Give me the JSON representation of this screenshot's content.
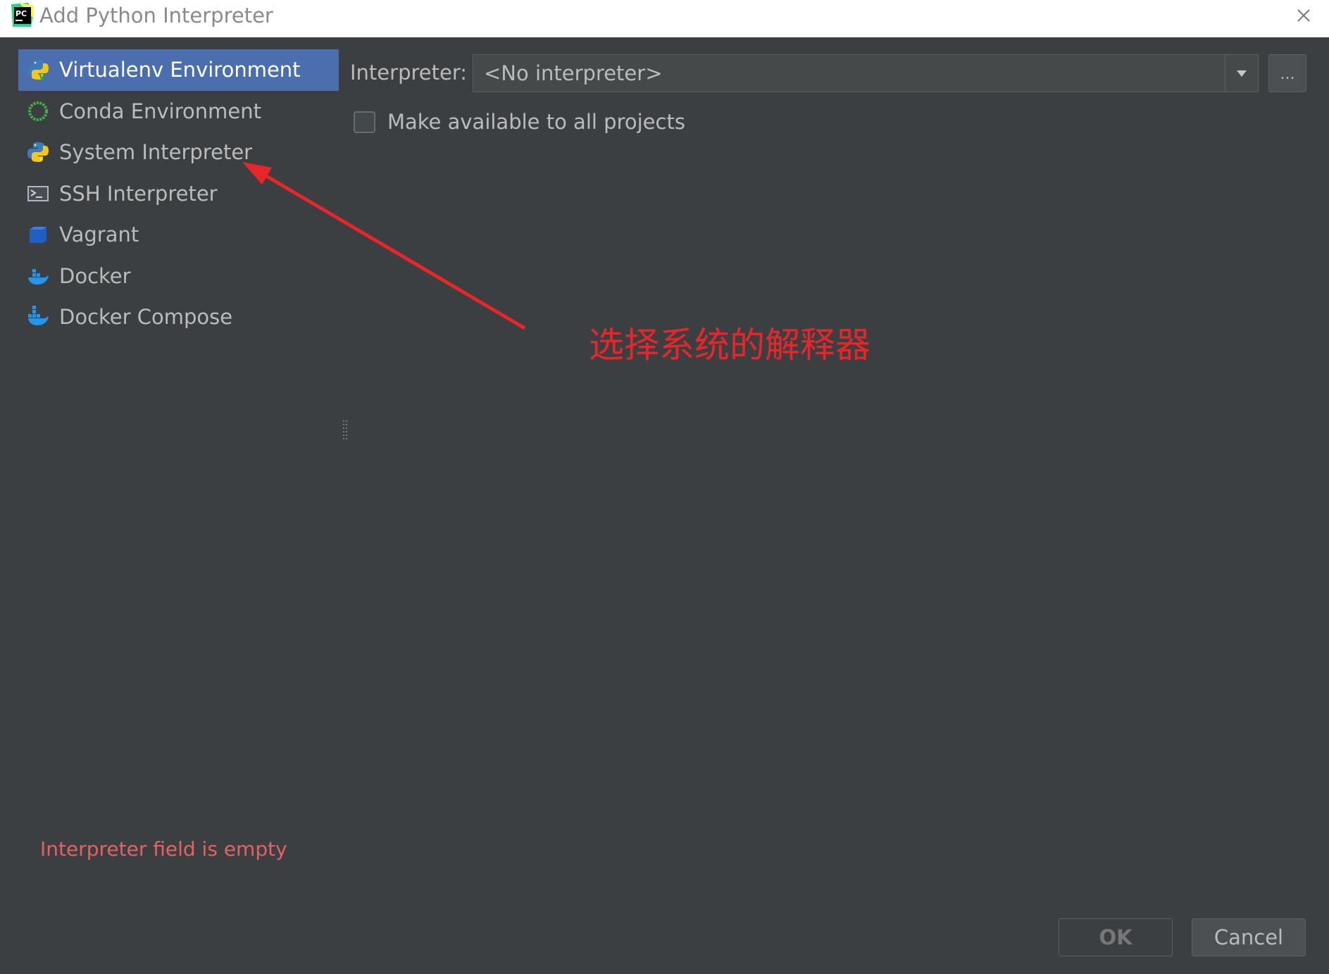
{
  "window": {
    "title": "Add Python Interpreter"
  },
  "sidebar": {
    "items": [
      {
        "label": "Virtualenv Environment",
        "icon": "virtualenv-icon",
        "selected": true
      },
      {
        "label": "Conda Environment",
        "icon": "conda-icon",
        "selected": false
      },
      {
        "label": "System Interpreter",
        "icon": "python-icon",
        "selected": false
      },
      {
        "label": "SSH Interpreter",
        "icon": "terminal-icon",
        "selected": false
      },
      {
        "label": "Vagrant",
        "icon": "vagrant-icon",
        "selected": false
      },
      {
        "label": "Docker",
        "icon": "docker-icon",
        "selected": false
      },
      {
        "label": "Docker Compose",
        "icon": "docker-compose-icon",
        "selected": false
      }
    ]
  },
  "main": {
    "interpreter_label": "Interpreter:",
    "interpreter_value": "<No interpreter>",
    "browse_label": "...",
    "make_available_label": "Make available to all projects",
    "make_available_checked": false
  },
  "annotation": {
    "text": "选择系统的解释器",
    "color": "#e8262a"
  },
  "error": {
    "text": "Interpreter field is empty",
    "color": "#e36363"
  },
  "buttons": {
    "ok": "OK",
    "cancel": "Cancel"
  },
  "colors": {
    "background": "#3c3f41",
    "selection": "#4b6eaf",
    "text": "#bbbbbb"
  }
}
